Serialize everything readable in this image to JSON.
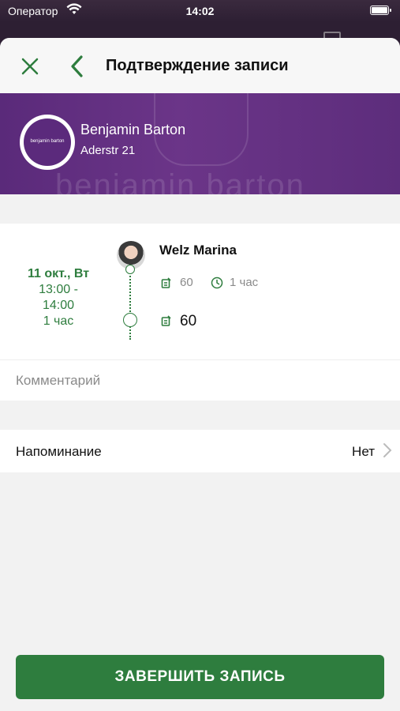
{
  "status": {
    "carrier": "Оператор",
    "time": "14:02"
  },
  "nav": {
    "title": "Подтверждение записи"
  },
  "salon": {
    "name": "Benjamin Barton",
    "address": "Aderstr 21",
    "logo_text": "benjamin barton",
    "watermark": "benjamin barton"
  },
  "appointment": {
    "date": "11 окт., Вт",
    "time_range": "13:00 -\n14:00",
    "duration": "1 час",
    "master": "Welz Marina",
    "service_price": "60",
    "service_duration": "1 час",
    "total": "60"
  },
  "comment": {
    "placeholder": "Комментарий",
    "value": ""
  },
  "reminder": {
    "label": "Напоминание",
    "value": "Нет"
  },
  "submit_label": "ЗАВЕРШИТЬ ЗАПИСЬ",
  "colors": {
    "accent": "#2e7d3e",
    "banner": "#5b2a7c"
  }
}
